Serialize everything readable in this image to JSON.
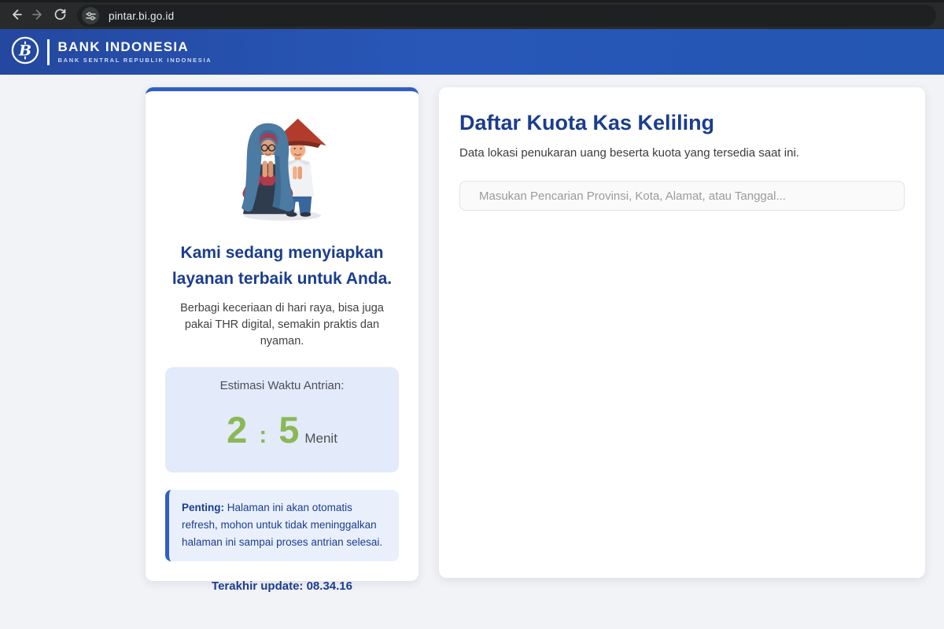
{
  "browser": {
    "url": "pintar.bi.go.id"
  },
  "header": {
    "title": "BANK INDONESIA",
    "tagline": "BANK SENTRAL REPUBLIK INDONESIA"
  },
  "queue_card": {
    "heading_line1": "Kami sedang menyiapkan",
    "heading_line2": "layanan terbaik untuk Anda.",
    "description": "Berbagi keceriaan di hari raya, bisa juga pakai THR digital, semakin praktis dan nyaman.",
    "estimation": {
      "label": "Estimasi Waktu Antrian:",
      "minutes": "2",
      "separator": ":",
      "seconds": "5",
      "unit": "Menit"
    },
    "notice": {
      "label": "Penting:",
      "text": " Halaman ini akan otomatis refresh, mohon untuk tidak meninggalkan halaman ini sampai proses antrian selesai."
    },
    "last_update": "Terakhir update: 08.34.16"
  },
  "quota_card": {
    "title": "Daftar Kuota Kas Keliling",
    "subtitle": "Data lokasi penukaran uang beserta kuota yang tersedia saat ini.",
    "search_placeholder": "Masukan Pencarian Provinsi, Kota, Alamat, atau Tanggal..."
  },
  "colors": {
    "header_blue": "#2456b2",
    "navy": "#1b3d8f",
    "green": "#8ab857",
    "accent_border": "#2f5fc4",
    "estimate_bg": "#e3eaf9",
    "notice_bg": "#e9f0fc",
    "toolbar_bg": "#282a2b",
    "page_bg": "#f2f3f6"
  }
}
